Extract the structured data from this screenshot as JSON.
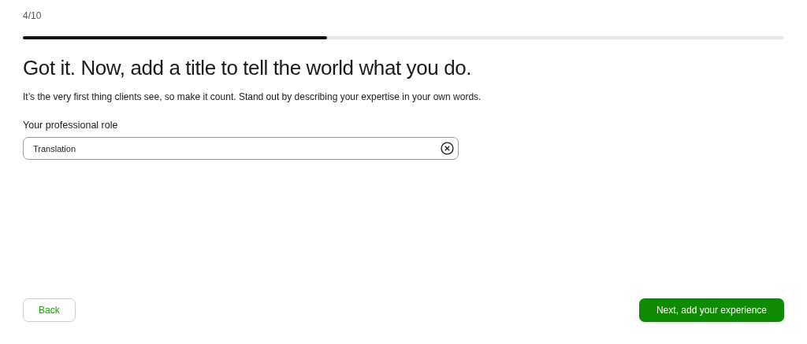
{
  "step": "4/10",
  "progress": {
    "level": 0.4
  },
  "heading": "Got it. Now, add a title to tell the world what you do.",
  "subtitle": "It’s the very first thing clients see, so make it count. Stand out by describing your expertise in your own words.",
  "field": {
    "label": "Your professional role",
    "value": "Translation"
  },
  "buttons": [
    {
      "label": "Back",
      "kind": "secondary"
    },
    {
      "label": "Next, add your experience",
      "kind": "primary"
    }
  ]
}
